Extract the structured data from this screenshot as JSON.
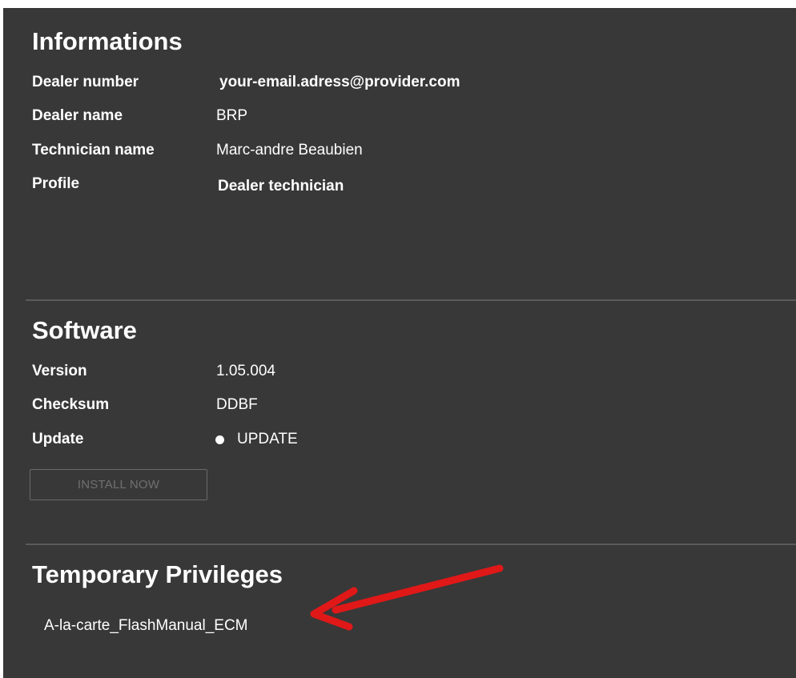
{
  "informations": {
    "title": "Informations",
    "rows": [
      {
        "label": "Dealer number",
        "value": "your-email.adress@provider.com"
      },
      {
        "label": "Dealer name",
        "value": "BRP"
      },
      {
        "label": "Technician name",
        "value": "Marc-andre Beaubien"
      },
      {
        "label": "Profile",
        "value": "Dealer technician"
      }
    ]
  },
  "software": {
    "title": "Software",
    "rows": [
      {
        "label": "Version",
        "value": "1.05.004"
      },
      {
        "label": "Checksum",
        "value": "DDBF"
      },
      {
        "label": "Update",
        "value": "UPDATE"
      }
    ],
    "install_button_label": "INSTALL NOW"
  },
  "temporary_privileges": {
    "title": "Temporary Privileges",
    "items": [
      "A-la-carte_FlashManual_ECM"
    ]
  },
  "colors": {
    "background": "#383838",
    "divider": "#5a5a5a",
    "text": "#ffffff",
    "disabled_text": "#707070",
    "annotation_arrow": "#e01818"
  },
  "icons": {
    "update_status": "status-dot-icon",
    "annotation": "red-arrow-icon"
  }
}
